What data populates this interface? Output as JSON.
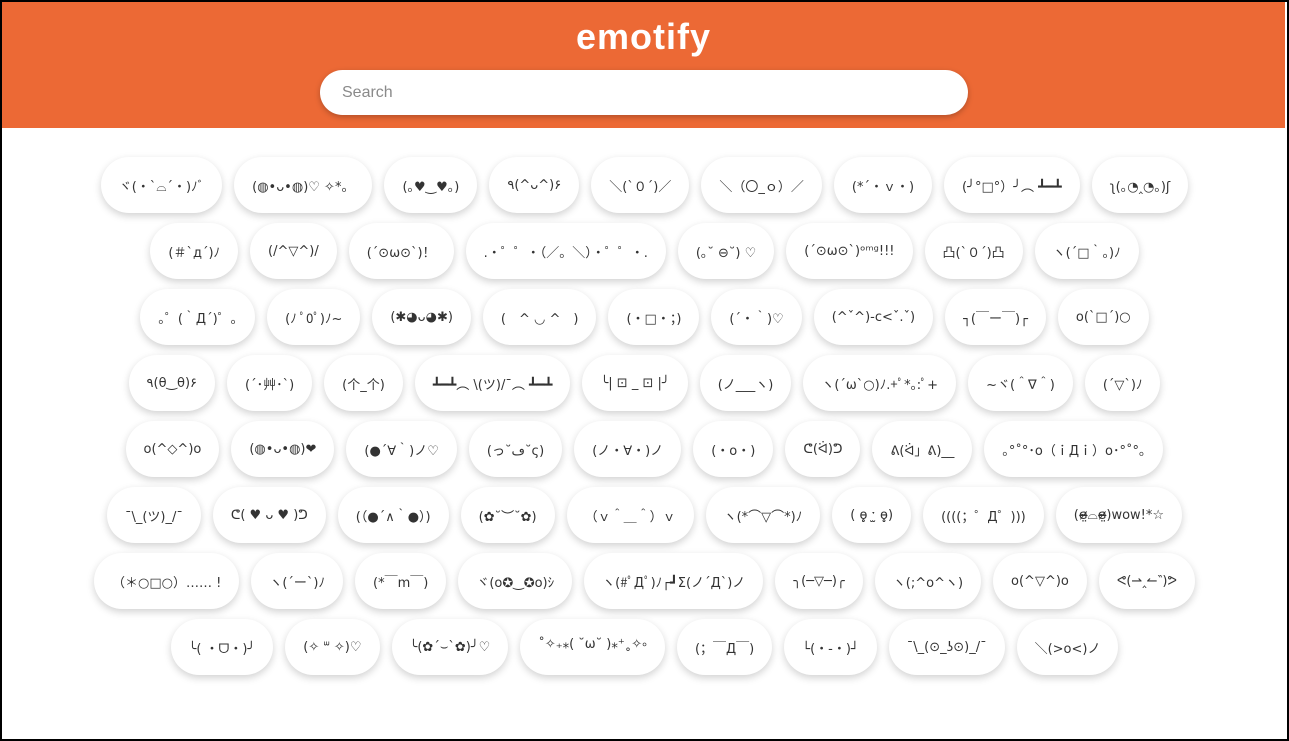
{
  "app": {
    "title": "emotify"
  },
  "search": {
    "placeholder": "Search"
  },
  "colors": {
    "header_bg": "#EC6935",
    "chip_bg": "#FFFFFF",
    "text": "#333333"
  },
  "rows": [
    [
      "ヾ(・`⌓´・)ﾉﾞ",
      "(◍•ᴗ•◍)♡ ✧*。",
      "(｡♥‿♥｡)",
      "٩(^ᴗ^)۶",
      "＼(`０´)／",
      "＼（〇_ｏ）／",
      "(*´・ｖ・)",
      "(╯°□°）╯︵ ┻━┻",
      "ʅ(｡◔‸◔｡)ʃ"
    ],
    [
      "(＃`д´)ﾉ",
      "(/^▽^)/",
      "(´⊙ω⊙`)！",
      ".・゜゜・（／。＼）・゜゜・.",
      "(｡˘ ⊖˘) ♡",
      "(´⊙ω⊙`)ᵒᵐᵍ!!!",
      "凸(`０´)凸",
      "ヽ(´□｀。)ﾉ"
    ],
    [
      "｡゜(｀Д´)゜｡",
      "(ﾉ ﾟ0ﾟ)ﾉ~",
      "(✱◕ᴗ◕✱)",
      "(　^ ◡ ^　)",
      "(・□・；)",
      "(´・｀)♡",
      "(^ˇ^)-c<ˇ.ˇ)",
      "┐(￣ー￣)┌",
      "o(`□´)○"
    ],
    [
      "٩(θ‿θ)۶",
      "(´･艸･`)",
      "(个_个)",
      "┻━┻︵ \\(ツ)/¯︵ ┻━┻",
      "╰| ⊡ _ ⊡ |╯",
      "(ノ___ヽ)",
      "ヽ(´ω`○)ﾉ.+ﾟ*｡:ﾟ+",
      "~ヾ(＾∇＾)",
      "(´▽`)ﾉ"
    ],
    [
      "o(^◇^)o",
      "(◍•ᴗ•◍)❤",
      "(●´∀｀)ノ♡",
      "(っ˘ڡ˘ς)",
      "(ノ・∀・)ノ",
      "(・o・)",
      "ᕦ(ᐛ)ᕤ",
      "ᕕ(ᐛ」ᕕ)__",
      "｡°˚°･o（ｉДｉ）o･°˚°｡"
    ],
    [
      "¯\\_(ツ)_/¯",
      "ᕦ( ♥ ᴗ ♥ )ᕤ",
      "(（●´∧｀●）)",
      "(✿˘︶˘✿)",
      "（ｖ＾＿＾）ｖ",
      "ヽ(*⌒▽⌒*)ﾉ",
      "( ɵ̥̥ ˑ̫ ɵ̥̥)",
      "((((；゜Д゜)))",
      "(ɞ̴̶̷̤⌓ɞ̴̶̷̤)wow!*☆"
    ],
    [
      "（＊○□○）…… !",
      "ヽ(´ー`)ﾉ",
      "(*￣m￣)",
      "ヾ(o✪‿✪o)ｼ",
      "ヽ(#ﾟДﾟ)ﾉ┌┛Σ(ノ´Д`)ノ",
      "╮(─▽─)╭",
      "ヽ(;^o^ヽ)",
      "o(^▽^)o",
      "ᕙ(⇀‸↼‶)ᕗ"
    ],
    [
      "╰( ・ᗜ・)╯",
      "(✧ ᐜ ✧)♡",
      "╰(✿´⌣`✿)╯♡",
      "˚✧₊⁎( ˘ω˘ )⁎⁺˳✧༚",
      "(；￣Д￣)",
      "└(・-・)┘",
      "¯\\_(⊙_ʖ⊙)_/¯",
      "＼(>o<)ノ"
    ]
  ]
}
